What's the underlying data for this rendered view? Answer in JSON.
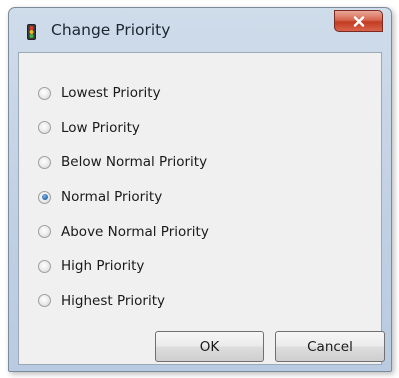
{
  "window": {
    "title": "Change Priority",
    "icon": "traffic-light-icon",
    "close_icon": "close-icon"
  },
  "options": [
    {
      "label": "Lowest Priority",
      "checked": false
    },
    {
      "label": "Low Priority",
      "checked": false
    },
    {
      "label": "Below Normal Priority",
      "checked": false
    },
    {
      "label": "Normal Priority",
      "checked": true
    },
    {
      "label": "Above Normal Priority",
      "checked": false
    },
    {
      "label": "High Priority",
      "checked": false
    },
    {
      "label": "Highest Priority",
      "checked": false
    }
  ],
  "buttons": {
    "ok": "OK",
    "cancel": "Cancel"
  },
  "colors": {
    "title_bar": "#c4d4e6",
    "close_button": "#c94a31",
    "selected_radio": "#2e6fb6"
  }
}
